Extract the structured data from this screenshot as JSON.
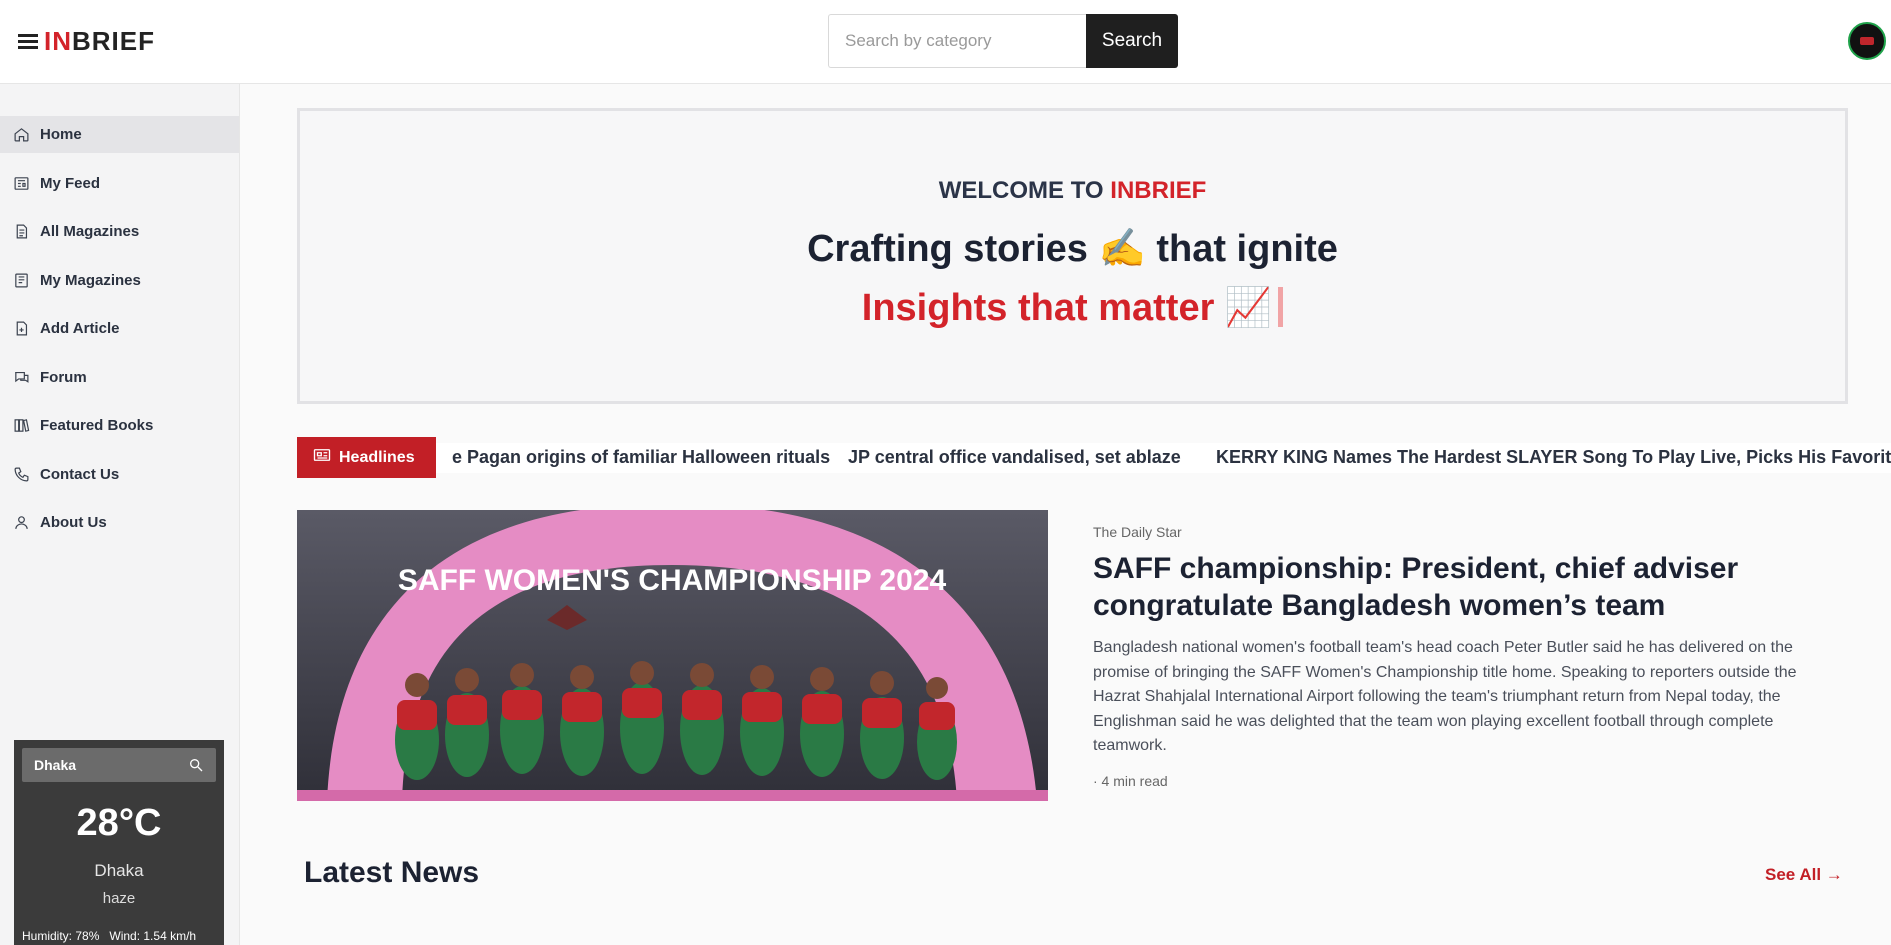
{
  "brand": {
    "prefix": "IN",
    "suffix": "BRIEF"
  },
  "search": {
    "placeholder": "Search by category",
    "button_label": "Search"
  },
  "sidebar": {
    "items": [
      {
        "label": "Home",
        "icon": "home-icon",
        "active": true
      },
      {
        "label": "My Feed",
        "icon": "newspaper-icon"
      },
      {
        "label": "All Magazines",
        "icon": "document-icon"
      },
      {
        "label": "My Magazines",
        "icon": "book-icon"
      },
      {
        "label": "Add Article",
        "icon": "file-plus-icon"
      },
      {
        "label": "Forum",
        "icon": "chat-icon"
      },
      {
        "label": "Featured Books",
        "icon": "books-icon"
      },
      {
        "label": "Contact Us",
        "icon": "phone-icon"
      },
      {
        "label": "About Us",
        "icon": "user-icon"
      }
    ]
  },
  "weather": {
    "city_input": "Dhaka",
    "temperature": "28°C",
    "city": "Dhaka",
    "description": "haze",
    "humidity": "Humidity:  78%",
    "wind": "Wind:  1.54 km/h"
  },
  "hero": {
    "welcome_prefix": "WELCOME TO ",
    "welcome_brand": "INBRIEF",
    "line1": "Crafting stories ✍️ that ignite",
    "line2": "Insights that matter 📈"
  },
  "headlines": {
    "label": "Headlines",
    "items": [
      "e Pagan origins of familiar Halloween rituals",
      "JP central office vandalised, set ablaze",
      "KERRY KING Names The Hardest SLAYER Song To Play Live, Picks His Favorite"
    ]
  },
  "feature": {
    "source": "The Daily Star",
    "title": "SAFF championship: President, chief adviser congratulate Bangladesh women’s team",
    "summary": "Bangladesh national women's football team's head coach Peter Butler said he has delivered on the promise of bringing the SAFF Women's Championship title home. Speaking to reporters outside the Hazrat Shahjalal International Airport following the team's triumphant return from Nepal today, the Englishman said he was delighted that the team won playing excellent football through complete teamwork.",
    "meta": "· 4 min read",
    "image_banner_text": "SAFF WOMEN'S CHAMPIONSHIP 2024"
  },
  "latest": {
    "title": "Latest News",
    "see_all": "See All →"
  }
}
